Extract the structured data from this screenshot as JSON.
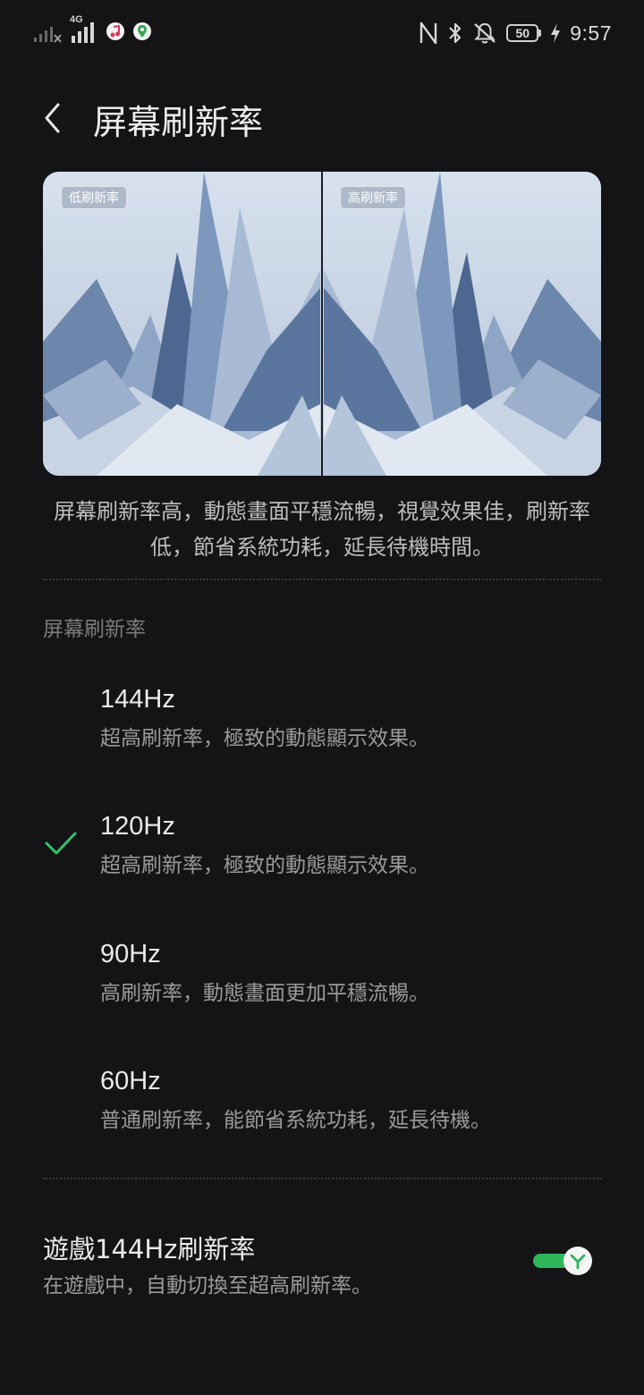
{
  "status_bar": {
    "network_type": "4G",
    "battery_level": "50",
    "time": "9:57",
    "icons": [
      "signal-icon-1",
      "signal-icon-2",
      "music-icon",
      "maps-icon",
      "nfc-icon",
      "bluetooth-icon",
      "mute-icon",
      "battery-icon",
      "charging-icon"
    ]
  },
  "header": {
    "back_icon": "chevron-left-icon",
    "title": "屏幕刷新率"
  },
  "preview": {
    "label_left": "低刷新率",
    "label_right": "高刷新率"
  },
  "description": "屏幕刷新率高，動態畫面平穩流暢，視覺效果佳，刷新率低，節省系統功耗，延長待機時間。",
  "section_header": "屏幕刷新率",
  "options": [
    {
      "title": "144Hz",
      "description": "超高刷新率，極致的動態顯示效果。",
      "selected": false
    },
    {
      "title": "120Hz",
      "description": "超高刷新率，極致的動態顯示效果。",
      "selected": true
    },
    {
      "title": "90Hz",
      "description": "高刷新率，動態畫面更加平穩流暢。",
      "selected": false
    },
    {
      "title": "60Hz",
      "description": "普通刷新率，能節省系統功耗，延長待機。",
      "selected": false
    }
  ],
  "game_setting": {
    "title": "遊戲144Hz刷新率",
    "description": "在遊戲中，自動切換至超高刷新率。",
    "enabled": true
  },
  "colors": {
    "background": "#141416",
    "accent_green": "#2eb65a",
    "check_green": "#34c16b"
  }
}
